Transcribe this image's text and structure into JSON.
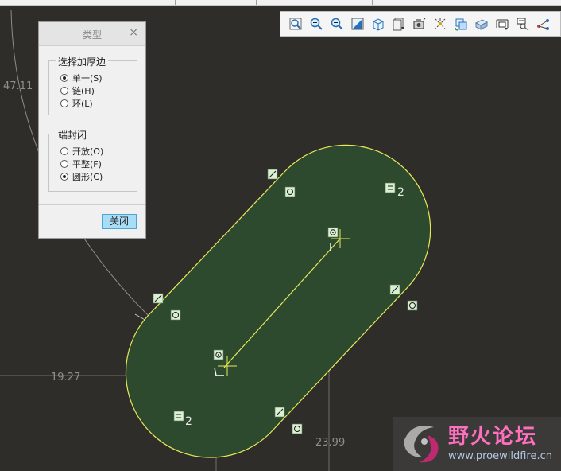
{
  "dialog": {
    "title": "类型",
    "close_glyph": "×",
    "thicken_group": {
      "legend": "选择加厚边",
      "options": [
        {
          "label": "单一(S)",
          "checked": true
        },
        {
          "label": "链(H)",
          "checked": false
        },
        {
          "label": "环(L)",
          "checked": false
        }
      ]
    },
    "endcap_group": {
      "legend": "端封闭",
      "options": [
        {
          "label": "开放(O)",
          "checked": false
        },
        {
          "label": "平整(F)",
          "checked": false
        },
        {
          "label": "圆形(C)",
          "checked": true
        }
      ]
    },
    "close_button_label": "关闭"
  },
  "dimensions": {
    "d1": "47.11",
    "d2": "19.27",
    "d3": "23.99",
    "equal_mark_1": "2",
    "equal_mark_2": "2"
  },
  "toolbar": {
    "icons": [
      "zoom-fit-icon",
      "zoom-in-icon",
      "zoom-out-icon",
      "reorient-icon",
      "view-orientation-icon",
      "saved-views-icon",
      "display-style-icon",
      "perspective-icon",
      "refit-icon",
      "section-icon",
      "sketch-display-icon",
      "constraint-display-icon",
      "grid-display-icon"
    ]
  },
  "watermark": {
    "title": "野火论坛",
    "url": "www.proewildfire.cn"
  },
  "colors": {
    "canvas": "#2f2d29",
    "shape_fill": "#2e4a2e",
    "shape_stroke": "#e8e85a",
    "accent_button": "#a9dcf5"
  }
}
